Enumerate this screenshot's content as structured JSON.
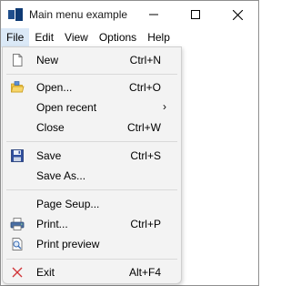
{
  "window": {
    "title": "Main menu example",
    "app_icon": "app-window-icon",
    "controls": {
      "minimize": "minimize-icon",
      "maximize": "maximize-icon",
      "close": "close-icon"
    }
  },
  "menubar": {
    "items": [
      {
        "label": "File",
        "active": true
      },
      {
        "label": "Edit"
      },
      {
        "label": "View"
      },
      {
        "label": "Options"
      },
      {
        "label": "Help"
      }
    ]
  },
  "file_menu": {
    "new": {
      "label": "New",
      "shortcut": "Ctrl+N",
      "icon": "new-document-icon"
    },
    "open": {
      "label": "Open...",
      "shortcut": "Ctrl+O",
      "icon": "open-folder-icon"
    },
    "open_recent": {
      "label": "Open recent",
      "submenu_arrow": "›"
    },
    "close": {
      "label": "Close",
      "shortcut": "Ctrl+W"
    },
    "save": {
      "label": "Save",
      "shortcut": "Ctrl+S",
      "icon": "save-floppy-icon"
    },
    "save_as": {
      "label": "Save As..."
    },
    "page_setup": {
      "label": "Page Seup..."
    },
    "print": {
      "label": "Print...",
      "shortcut": "Ctrl+P",
      "icon": "printer-icon"
    },
    "print_preview": {
      "label": "Print preview",
      "icon": "print-preview-icon"
    },
    "exit": {
      "label": "Exit",
      "shortcut": "Alt+F4",
      "icon": "exit-x-icon"
    }
  },
  "colors": {
    "menubar_active": "#dbe9f7",
    "popup_bg": "#f3f3f3",
    "exit_icon": "#d13438",
    "save_icon": "#2f4f9e"
  }
}
